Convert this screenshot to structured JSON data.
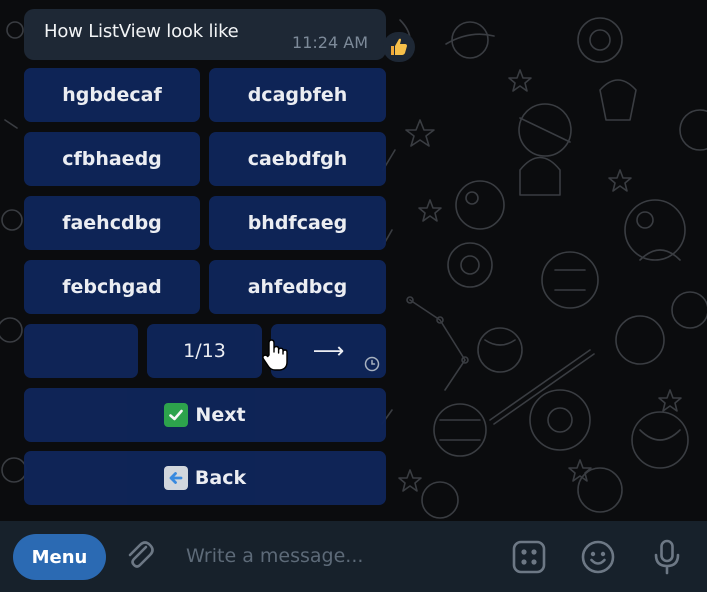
{
  "message": {
    "text": "How ListView look like",
    "time": "11:24 AM",
    "reaction": "thumbs-up"
  },
  "keyboard": {
    "rows": [
      [
        "hgbdecaf",
        "dcagbfeh"
      ],
      [
        "cfbhaedg",
        "caebdfgh"
      ],
      [
        "faehcdbg",
        "bhdfcaeg"
      ],
      [
        "febchgad",
        "ahfedbcg"
      ]
    ],
    "pager": {
      "left": "",
      "page": "1/13",
      "right": "⟶"
    },
    "next": {
      "emoji": "check-mark-emoji",
      "label": "Next"
    },
    "back": {
      "emoji": "left-arrow-emoji",
      "label": "Back"
    }
  },
  "input_bar": {
    "menu_label": "Menu",
    "placeholder": "Write a message..."
  },
  "colors": {
    "background": "#0b0c0e",
    "bubble": "#1e2835",
    "button": "#0f2559",
    "input_bar": "#17212b",
    "menu_button": "#2b6ab3",
    "accent_check": "#2fa84f",
    "accent_back": "#3a8ee6"
  }
}
